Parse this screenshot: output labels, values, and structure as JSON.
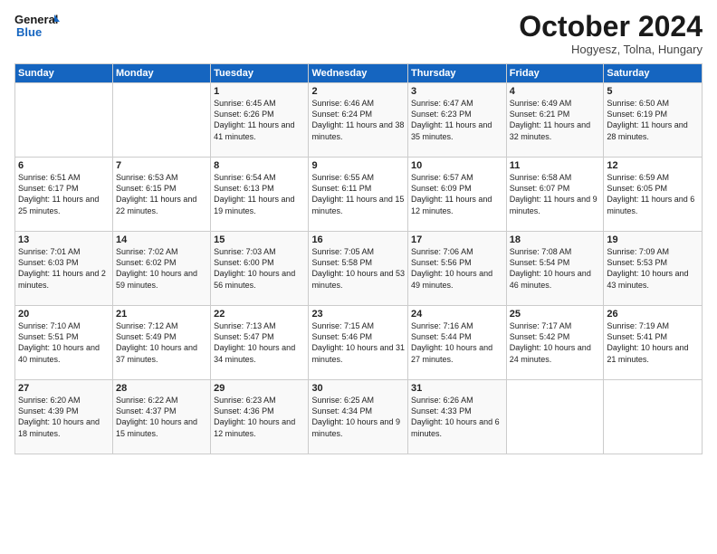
{
  "header": {
    "logo_line1": "General",
    "logo_line2": "Blue",
    "month": "October 2024",
    "location": "Hogyesz, Tolna, Hungary"
  },
  "days_of_week": [
    "Sunday",
    "Monday",
    "Tuesday",
    "Wednesday",
    "Thursday",
    "Friday",
    "Saturday"
  ],
  "weeks": [
    [
      {
        "day": "",
        "info": ""
      },
      {
        "day": "",
        "info": ""
      },
      {
        "day": "1",
        "info": "Sunrise: 6:45 AM\nSunset: 6:26 PM\nDaylight: 11 hours and 41 minutes."
      },
      {
        "day": "2",
        "info": "Sunrise: 6:46 AM\nSunset: 6:24 PM\nDaylight: 11 hours and 38 minutes."
      },
      {
        "day": "3",
        "info": "Sunrise: 6:47 AM\nSunset: 6:23 PM\nDaylight: 11 hours and 35 minutes."
      },
      {
        "day": "4",
        "info": "Sunrise: 6:49 AM\nSunset: 6:21 PM\nDaylight: 11 hours and 32 minutes."
      },
      {
        "day": "5",
        "info": "Sunrise: 6:50 AM\nSunset: 6:19 PM\nDaylight: 11 hours and 28 minutes."
      }
    ],
    [
      {
        "day": "6",
        "info": "Sunrise: 6:51 AM\nSunset: 6:17 PM\nDaylight: 11 hours and 25 minutes."
      },
      {
        "day": "7",
        "info": "Sunrise: 6:53 AM\nSunset: 6:15 PM\nDaylight: 11 hours and 22 minutes."
      },
      {
        "day": "8",
        "info": "Sunrise: 6:54 AM\nSunset: 6:13 PM\nDaylight: 11 hours and 19 minutes."
      },
      {
        "day": "9",
        "info": "Sunrise: 6:55 AM\nSunset: 6:11 PM\nDaylight: 11 hours and 15 minutes."
      },
      {
        "day": "10",
        "info": "Sunrise: 6:57 AM\nSunset: 6:09 PM\nDaylight: 11 hours and 12 minutes."
      },
      {
        "day": "11",
        "info": "Sunrise: 6:58 AM\nSunset: 6:07 PM\nDaylight: 11 hours and 9 minutes."
      },
      {
        "day": "12",
        "info": "Sunrise: 6:59 AM\nSunset: 6:05 PM\nDaylight: 11 hours and 6 minutes."
      }
    ],
    [
      {
        "day": "13",
        "info": "Sunrise: 7:01 AM\nSunset: 6:03 PM\nDaylight: 11 hours and 2 minutes."
      },
      {
        "day": "14",
        "info": "Sunrise: 7:02 AM\nSunset: 6:02 PM\nDaylight: 10 hours and 59 minutes."
      },
      {
        "day": "15",
        "info": "Sunrise: 7:03 AM\nSunset: 6:00 PM\nDaylight: 10 hours and 56 minutes."
      },
      {
        "day": "16",
        "info": "Sunrise: 7:05 AM\nSunset: 5:58 PM\nDaylight: 10 hours and 53 minutes."
      },
      {
        "day": "17",
        "info": "Sunrise: 7:06 AM\nSunset: 5:56 PM\nDaylight: 10 hours and 49 minutes."
      },
      {
        "day": "18",
        "info": "Sunrise: 7:08 AM\nSunset: 5:54 PM\nDaylight: 10 hours and 46 minutes."
      },
      {
        "day": "19",
        "info": "Sunrise: 7:09 AM\nSunset: 5:53 PM\nDaylight: 10 hours and 43 minutes."
      }
    ],
    [
      {
        "day": "20",
        "info": "Sunrise: 7:10 AM\nSunset: 5:51 PM\nDaylight: 10 hours and 40 minutes."
      },
      {
        "day": "21",
        "info": "Sunrise: 7:12 AM\nSunset: 5:49 PM\nDaylight: 10 hours and 37 minutes."
      },
      {
        "day": "22",
        "info": "Sunrise: 7:13 AM\nSunset: 5:47 PM\nDaylight: 10 hours and 34 minutes."
      },
      {
        "day": "23",
        "info": "Sunrise: 7:15 AM\nSunset: 5:46 PM\nDaylight: 10 hours and 31 minutes."
      },
      {
        "day": "24",
        "info": "Sunrise: 7:16 AM\nSunset: 5:44 PM\nDaylight: 10 hours and 27 minutes."
      },
      {
        "day": "25",
        "info": "Sunrise: 7:17 AM\nSunset: 5:42 PM\nDaylight: 10 hours and 24 minutes."
      },
      {
        "day": "26",
        "info": "Sunrise: 7:19 AM\nSunset: 5:41 PM\nDaylight: 10 hours and 21 minutes."
      }
    ],
    [
      {
        "day": "27",
        "info": "Sunrise: 6:20 AM\nSunset: 4:39 PM\nDaylight: 10 hours and 18 minutes."
      },
      {
        "day": "28",
        "info": "Sunrise: 6:22 AM\nSunset: 4:37 PM\nDaylight: 10 hours and 15 minutes."
      },
      {
        "day": "29",
        "info": "Sunrise: 6:23 AM\nSunset: 4:36 PM\nDaylight: 10 hours and 12 minutes."
      },
      {
        "day": "30",
        "info": "Sunrise: 6:25 AM\nSunset: 4:34 PM\nDaylight: 10 hours and 9 minutes."
      },
      {
        "day": "31",
        "info": "Sunrise: 6:26 AM\nSunset: 4:33 PM\nDaylight: 10 hours and 6 minutes."
      },
      {
        "day": "",
        "info": ""
      },
      {
        "day": "",
        "info": ""
      }
    ]
  ]
}
